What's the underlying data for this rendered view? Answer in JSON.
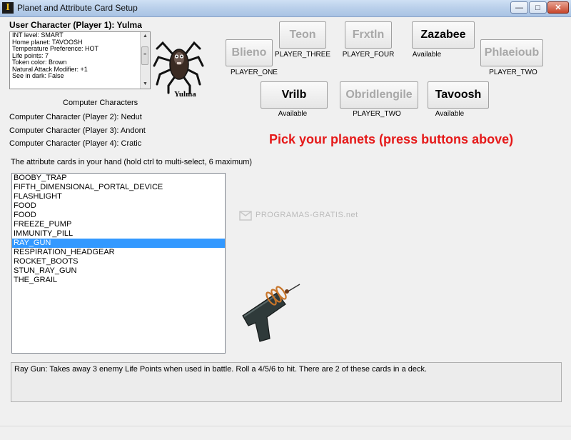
{
  "window": {
    "title": "Planet and Attribute Card Setup",
    "app_icon_glyph": "I",
    "minimize_glyph": "—",
    "maximize_glyph": "□",
    "close_glyph": "✕"
  },
  "user": {
    "heading": "User Character (Player 1): Yulma",
    "stats": [
      "INT level: SMART",
      "Home planet: TAVOOSH",
      "Temperature Preference: HOT",
      "Life points: 7",
      "Token color: Brown",
      "Natural Attack Modifier: +1",
      "See in dark: False"
    ],
    "avatar_name": "Yulma"
  },
  "computer": {
    "heading": "Computer Characters",
    "players": [
      "Computer Character (Player 2): Nedut",
      "Computer Character (Player 3): Andont",
      "Computer Character (Player 4): Cratic"
    ]
  },
  "planets": {
    "teon": {
      "label": "Teon",
      "status": "PLAYER_THREE",
      "enabled": false
    },
    "frxtln": {
      "label": "Frxtln",
      "status": "PLAYER_FOUR",
      "enabled": false
    },
    "zazabee": {
      "label": "Zazabee",
      "status": "Available",
      "enabled": true
    },
    "blieno": {
      "label": "Blieno",
      "status": "PLAYER_ONE",
      "enabled": false
    },
    "phlaeioub": {
      "label": "Phlaeioub",
      "status": "PLAYER_TWO",
      "enabled": false
    },
    "vrilb": {
      "label": "Vrilb",
      "status": "Available",
      "enabled": true
    },
    "obridlengile": {
      "label": "Obridlengile",
      "status": "PLAYER_TWO",
      "enabled": false
    },
    "tavoosh": {
      "label": "Tavoosh",
      "status": "Available",
      "enabled": true
    }
  },
  "instruction": "Pick your planets (press buttons above)",
  "cards": {
    "label": "The attribute cards in your hand (hold ctrl to multi-select, 6 maximum)",
    "items": [
      "BOOBY_TRAP",
      "FIFTH_DIMENSIONAL_PORTAL_DEVICE",
      "FLASHLIGHT",
      "FOOD",
      "FOOD",
      "FREEZE_PUMP",
      "IMMUNITY_PILL",
      "RAY_GUN",
      "RESPIRATION_HEADGEAR",
      "ROCKET_BOOTS",
      "STUN_RAY_GUN",
      "THE_GRAIL"
    ],
    "selected": "RAY_GUN"
  },
  "watermark": "PROGRAMAS-GRATIS.net",
  "description": "Ray Gun: Takes away 3 enemy Life Points when used in battle. Roll a 4/5/6 to hit. There are 2 of these cards in a deck.",
  "colors": {
    "instruction": "#e51919",
    "selection": "#3399ff",
    "disabled_text": "#a8a8a8"
  }
}
